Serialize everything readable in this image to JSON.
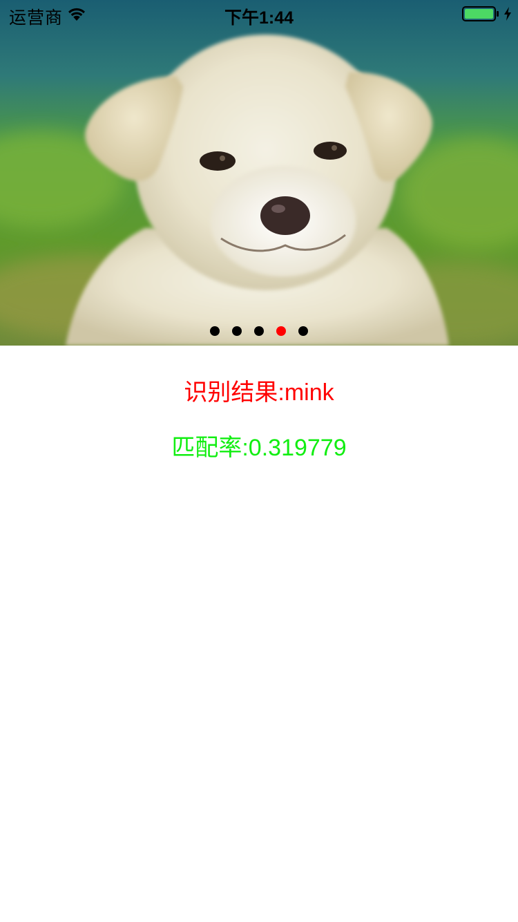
{
  "status_bar": {
    "carrier": "运营商",
    "time": "下午1:44",
    "icons": [
      "wifi-icon",
      "battery-icon",
      "charging-bolt-icon"
    ],
    "battery_color": "#4cd964"
  },
  "carousel": {
    "image": "white-puppy-on-grass",
    "page_count": 5,
    "current_page": 4,
    "dot_color": "#000000",
    "active_dot_color": "#ff0000"
  },
  "result": {
    "label_text": "识别结果:mink",
    "match_rate_text": "匹配率:0.319779",
    "label_color": "#ff0000",
    "match_rate_color": "#11ee11"
  }
}
